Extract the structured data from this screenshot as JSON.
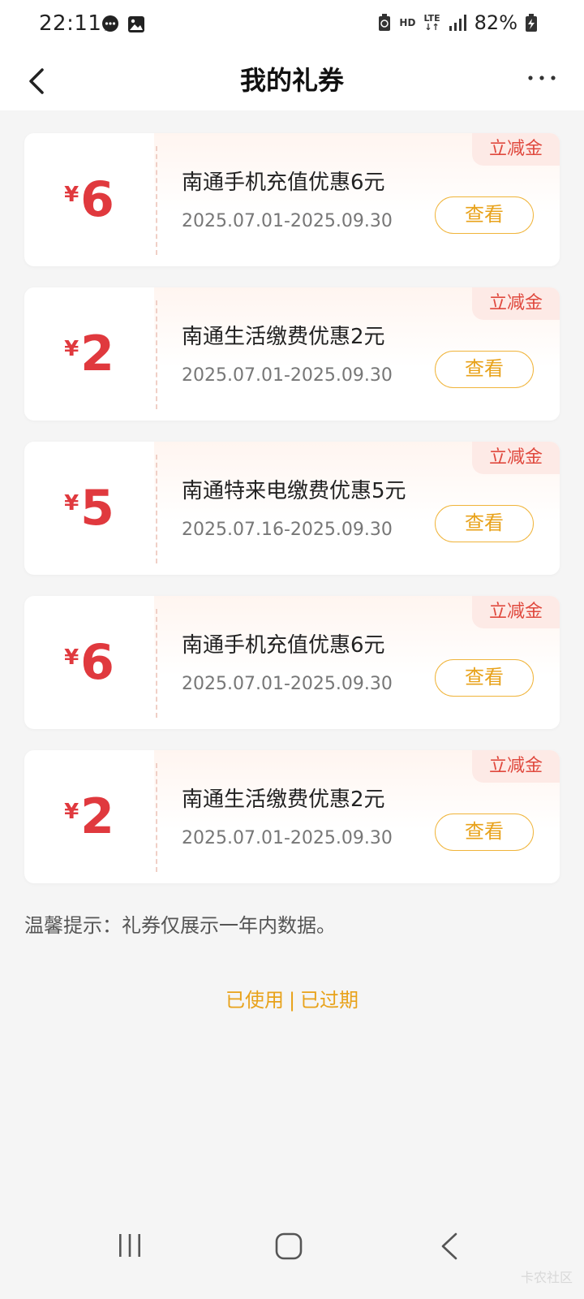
{
  "status_bar": {
    "time": "22:11",
    "network_label": "HD",
    "lte_label": "LTE",
    "battery_percent": "82%"
  },
  "header": {
    "title": "我的礼券"
  },
  "coupons": [
    {
      "currency": "¥",
      "amount": "6",
      "title": "南通手机充值优惠6元",
      "validity": "2025.07.01-2025.09.30",
      "tag": "立减金",
      "button": "查看"
    },
    {
      "currency": "¥",
      "amount": "2",
      "title": "南通生活缴费优惠2元",
      "validity": "2025.07.01-2025.09.30",
      "tag": "立减金",
      "button": "查看"
    },
    {
      "currency": "¥",
      "amount": "5",
      "title": "南通特来电缴费优惠5元",
      "validity": "2025.07.16-2025.09.30",
      "tag": "立减金",
      "button": "查看"
    },
    {
      "currency": "¥",
      "amount": "6",
      "title": "南通手机充值优惠6元",
      "validity": "2025.07.01-2025.09.30",
      "tag": "立减金",
      "button": "查看"
    },
    {
      "currency": "¥",
      "amount": "2",
      "title": "南通生活缴费优惠2元",
      "validity": "2025.07.01-2025.09.30",
      "tag": "立减金",
      "button": "查看"
    }
  ],
  "footer": {
    "tip": "温馨提示：礼券仅展示一年内数据。",
    "used_link": "已使用",
    "separator": "|",
    "expired_link": "已过期",
    "watermark": "卡农社区"
  },
  "colors": {
    "accent_red": "#e0393e",
    "accent_orange": "#e8a21a",
    "background": "#f5f5f5"
  },
  "icons": {
    "back": "chevron-left-icon",
    "more": "more-dots-icon",
    "nav_recent": "recent-apps-icon",
    "nav_home": "home-icon",
    "nav_back": "system-back-icon"
  }
}
